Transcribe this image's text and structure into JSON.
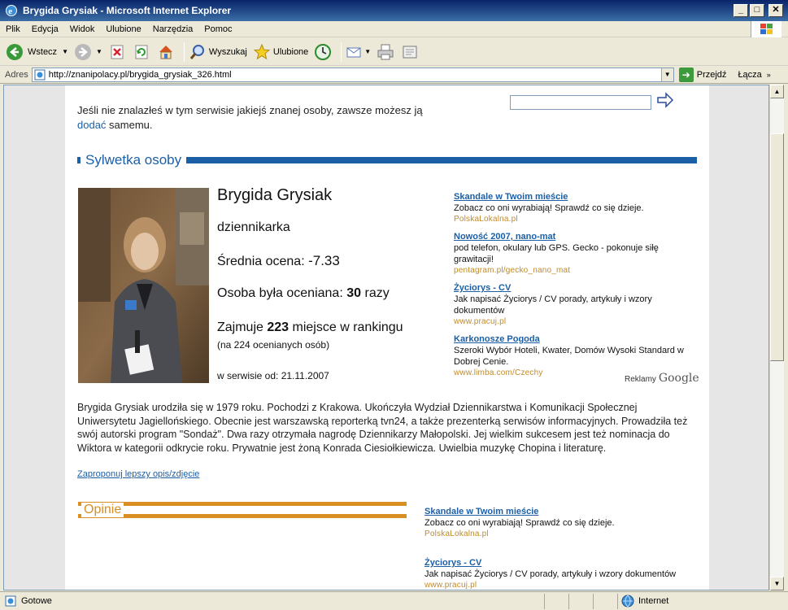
{
  "window": {
    "title": "Brygida Grysiak - Microsoft Internet Explorer"
  },
  "menu": [
    "Plik",
    "Edycja",
    "Widok",
    "Ulubione",
    "Narzędzia",
    "Pomoc"
  ],
  "toolbar": {
    "back": "Wstecz",
    "search": "Wyszukaj",
    "favorites": "Ulubione"
  },
  "address": {
    "label": "Adres",
    "url": "http://znanipolacy.pl/brygida_grysiak_326.html",
    "go": "Przejdź",
    "links": "Łącza"
  },
  "page": {
    "intro_text": "Jeśli nie znalazłeś w tym serwisie jakiejś znanej osoby, zawsze możesz ją",
    "intro_link": "dodać",
    "intro_after": "samemu.",
    "section_title": "Sylwetka osoby",
    "person": {
      "name": "Brygida Grysiak",
      "role": "dziennikarka",
      "avg_label": "Średnia ocena:",
      "avg_value": "-7.33",
      "rated_label": "Osoba była oceniana:",
      "rated_value": "30",
      "rated_suffix": "razy",
      "rank_prefix": "Zajmuje",
      "rank_value": "223",
      "rank_suffix": "miejsce w rankingu",
      "rank_note": "(na 224 ocenianych osób)",
      "since": "w serwisie od: 21.11.2007"
    },
    "ads": [
      {
        "title": "Skandale w Twoim mieście",
        "desc": "Zobacz co oni wyrabiają! Sprawdź co się dzieje.",
        "url": "PolskaLokalna.pl"
      },
      {
        "title": "Nowość 2007, nano-mat",
        "desc": "pod telefon, okulary lub GPS. Gecko - pokonuje siłę grawitacji!",
        "url": "pentagram.pl/gecko_nano_mat"
      },
      {
        "title": "Życiorys - CV",
        "desc": "Jak napisać Życiorys / CV porady, artykuły i wzory dokumentów",
        "url": "www.pracuj.pl"
      },
      {
        "title": "Karkonosze Pogoda",
        "desc": "Szeroki Wybór Hoteli, Kwater, Domów Wysoki Standard w Dobrej Cenie.",
        "url": "www.limba.com/Czechy"
      }
    ],
    "ads_by": "Reklamy",
    "ads_brand": "Google",
    "bio": "Brygida Grysiak urodziła się w 1979 roku. Pochodzi z Krakowa. Ukończyła Wydział Dziennikarstwa i Komunikacji Społecznej Uniwersytetu Jagiellońskiego. Obecnie jest warszawską reporterką tvn24, a także prezenterką serwisów informacyjnych. Prowadziła też swój autorski program \"Sondaż\". Dwa razy otrzymała nagrodę Dziennikarzy Małopolski. Jej wielkim sukcesem jest też nominacja do Wiktora w kategorii odkrycie roku. Prywatnie jest żoną Konrada Ciesiołkiewicza. Uwielbia muzykę Chopina i literaturę.",
    "suggest_link": "Zaproponuj lepszy opis/zdjęcie",
    "opinions_title": "Opinie",
    "ads2": [
      {
        "title": "Skandale w Twoim mieście",
        "desc": "Zobacz co oni wyrabiają! Sprawdź co się dzieje.",
        "url": "PolskaLokalna.pl"
      },
      {
        "title": "Życiorys - CV",
        "desc": "Jak napisać Życiorys / CV porady, artykuły i wzory dokumentów",
        "url": "www.pracuj.pl"
      }
    ]
  },
  "status": {
    "text": "Gotowe",
    "zone": "Internet"
  }
}
